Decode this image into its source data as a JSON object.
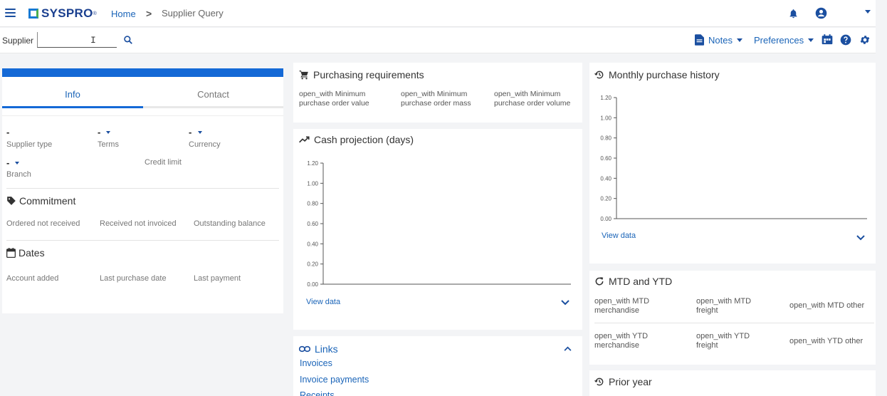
{
  "header": {
    "brand": "SYSPRO",
    "brand_tm": "®",
    "breadcrumb": {
      "home": "Home",
      "separator": ">",
      "current": "Supplier Query"
    }
  },
  "searchbar": {
    "label": "Supplier",
    "value": "",
    "notes_label": "Notes",
    "preferences_label": "Preferences"
  },
  "supplier_panel": {
    "tabs": [
      "Info",
      "Contact"
    ],
    "active_tab": "Info",
    "fields": {
      "supplier_type": {
        "label": "Supplier type",
        "value": "-"
      },
      "terms": {
        "label": "Terms",
        "value": "-"
      },
      "currency": {
        "label": "Currency",
        "value": "-"
      },
      "branch": {
        "label": "Branch",
        "value": "-"
      },
      "credit_limit": {
        "label": "Credit limit"
      }
    },
    "commitment": {
      "title": "Commitment",
      "fields": [
        "Ordered not received",
        "Received not invoiced",
        "Outstanding balance"
      ]
    },
    "dates": {
      "title": "Dates",
      "fields": [
        "Account added",
        "Last purchase date",
        "Last payment"
      ]
    }
  },
  "purchasing": {
    "title": "Purchasing requirements",
    "items": [
      {
        "line1": "open_with Minimum",
        "line2": "purchase order value"
      },
      {
        "line1": "open_with Minimum",
        "line2": "purchase order mass"
      },
      {
        "line1": "open_with Minimum",
        "line2": "purchase order volume"
      }
    ]
  },
  "cash_projection": {
    "title": "Cash projection (days)",
    "view_data": "View data"
  },
  "monthly_history": {
    "title": "Monthly purchase history",
    "view_data": "View data"
  },
  "mtd_ytd": {
    "title": "MTD and YTD",
    "mtd": [
      {
        "line1": "open_with MTD",
        "line2": "merchandise"
      },
      {
        "line1": "open_with MTD",
        "line2": "freight"
      },
      {
        "line1": "open_with MTD other",
        "line2": ""
      }
    ],
    "ytd": [
      {
        "line1": "open_with YTD",
        "line2": "merchandise"
      },
      {
        "line1": "open_with YTD",
        "line2": "freight"
      },
      {
        "line1": "open_with YTD other",
        "line2": ""
      }
    ]
  },
  "prior_year": {
    "title": "Prior year"
  },
  "links": {
    "title": "Links",
    "items": [
      "Invoices",
      "Invoice payments",
      "Receipts"
    ]
  },
  "chart_data": [
    {
      "type": "line",
      "x": [],
      "series": [],
      "ylim": [
        0,
        1.2
      ],
      "yticks": [
        "1.20",
        "1.00",
        "0.80",
        "0.60",
        "0.40",
        "0.20",
        "0.00"
      ]
    },
    {
      "type": "line",
      "x": [],
      "series": [],
      "ylim": [
        0,
        1.2
      ],
      "yticks": [
        "1.20",
        "1.00",
        "0.80",
        "0.60",
        "0.40",
        "0.20",
        "0.00"
      ]
    }
  ]
}
